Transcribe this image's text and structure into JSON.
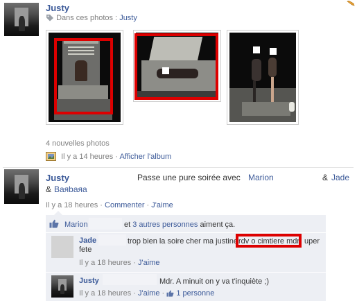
{
  "post1": {
    "author": "Justy",
    "tag_prefix": "Dans ces photos :",
    "tag_name": "Justy",
    "photo_count_text": "4 nouvelles photos",
    "time": "Il y a 14 heures",
    "separator": "·",
    "album_link": "Afficher l'album"
  },
  "post2": {
    "author": "Justy",
    "status_text": "Passe une pure soirée avec",
    "mention1": "Marion",
    "mention2": "Jade",
    "mention3_prefix": "&",
    "mention3": "Baяbaяa",
    "amp": "&",
    "time": "Il y a 18 heures",
    "separator": "·",
    "comment_link": "Commenter",
    "like_link": "J'aime",
    "likes": {
      "name": "Marion",
      "and_text": "et",
      "others_link": "3 autres personnes",
      "suffix": "aiment ça."
    },
    "comments": [
      {
        "author": "Jade",
        "text_before": "trop bien la soire cher ma justine",
        "highlight": "rdv o cimtiere mdr",
        "text_after": "uper",
        "text_line2": "fete",
        "time": "Il y a 18 heures",
        "separator": "·",
        "like_link": "J'aime"
      },
      {
        "author": "Justy",
        "text": "Mdr. A minuit on y va t'inquiète ;)",
        "time": "Il y a 18 heures",
        "separator": "·",
        "like_link": "J'aime",
        "like_count": "1 personne"
      }
    ]
  },
  "colors": {
    "link": "#3b5998",
    "highlight_red": "#dd0000",
    "comment_bg": "#edeff4"
  },
  "icons": {
    "tag": "tag-icon",
    "album": "album-icon",
    "thumbs_up": "thumbs-up-icon",
    "pencil": "pencil-icon"
  }
}
